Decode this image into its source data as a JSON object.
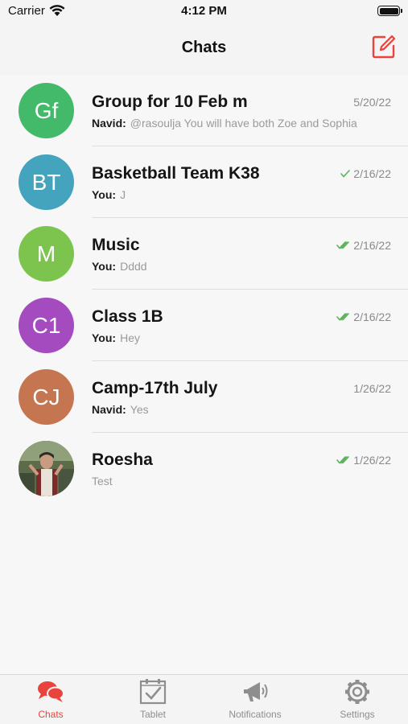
{
  "status_bar": {
    "carrier": "Carrier",
    "time": "4:12 PM"
  },
  "nav": {
    "title": "Chats",
    "compose_icon": "compose-icon"
  },
  "colors": {
    "accent": "#e9433d",
    "tick": "#5bb35b"
  },
  "chats": [
    {
      "initials": "Gf",
      "avatar_color": "#43b96a",
      "name": "Group for 10 Feb m",
      "sender": "Navid:",
      "message": "@rasoulja  You will have both Zoe and Sophia",
      "date": "5/20/22",
      "ticks": "none"
    },
    {
      "initials": "BT",
      "avatar_color": "#44a3bd",
      "name": "Basketball Team K38",
      "sender": "You:",
      "message": "J",
      "date": "2/16/22",
      "ticks": "single"
    },
    {
      "initials": "M",
      "avatar_color": "#7cc44e",
      "name": "Music",
      "sender": "You:",
      "message": "Dddd",
      "date": "2/16/22",
      "ticks": "double"
    },
    {
      "initials": "C1",
      "avatar_color": "#a54bc0",
      "name": "Class 1B",
      "sender": "You:",
      "message": "Hey",
      "date": "2/16/22",
      "ticks": "double"
    },
    {
      "initials": "CJ",
      "avatar_color": "#c57650",
      "name": "Camp-17th July",
      "sender": "Navid:",
      "message": "Yes",
      "date": "1/26/22",
      "ticks": "none"
    },
    {
      "initials": "",
      "avatar_color": "#6b5a4a",
      "name": "Roesha",
      "sender": "",
      "message": "Test",
      "date": "1/26/22",
      "ticks": "double"
    }
  ],
  "tabs": [
    {
      "label": "Chats",
      "icon": "chat-bubbles-icon",
      "active": true
    },
    {
      "label": "Tablet",
      "icon": "tablet-check-icon",
      "active": false
    },
    {
      "label": "Notifications",
      "icon": "megaphone-icon",
      "active": false
    },
    {
      "label": "Settings",
      "icon": "gear-icon",
      "active": false
    }
  ]
}
